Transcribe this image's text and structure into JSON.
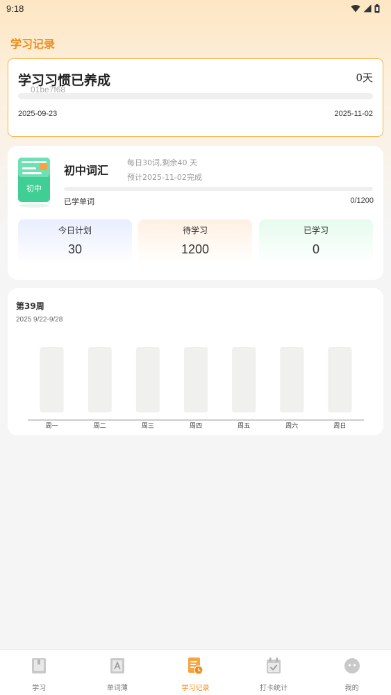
{
  "status_bar": {
    "time": "9:18"
  },
  "page": {
    "title": "学习记录"
  },
  "habit": {
    "title": "学习习惯已养成",
    "days": "0天",
    "code": "01be7f68",
    "progress": 0,
    "start_date": "2025-09-23",
    "end_date": "2025-11-02"
  },
  "vocab": {
    "name": "初中词汇",
    "badge": "初中",
    "daily_plan": "每日30词,剩余40 天",
    "eta": "预计2025-11-02完成",
    "learned_label": "已学单词",
    "learned_count": "0/1200",
    "progress": 0,
    "stats": [
      {
        "label": "今日计划",
        "value": "30"
      },
      {
        "label": "待学习",
        "value": "1200"
      },
      {
        "label": "已学习",
        "value": "0"
      }
    ]
  },
  "week": {
    "title": "第39周",
    "range": "2025 9/22-9/28"
  },
  "chart_data": {
    "type": "bar",
    "categories": [
      "周一",
      "周二",
      "周三",
      "周四",
      "周五",
      "周六",
      "周日"
    ],
    "values": [
      0,
      0,
      0,
      0,
      0,
      0,
      0
    ],
    "title": "",
    "xlabel": "",
    "ylabel": "",
    "grid": false
  },
  "nav": {
    "items": [
      {
        "label": "学习",
        "icon": "book-icon",
        "active": false
      },
      {
        "label": "单词薄",
        "icon": "letter-a-icon",
        "active": false
      },
      {
        "label": "学习记录",
        "icon": "record-clock-icon",
        "active": true
      },
      {
        "label": "打卡统计",
        "icon": "calendar-check-icon",
        "active": false
      },
      {
        "label": "我的",
        "icon": "profile-icon",
        "active": false
      }
    ]
  },
  "colors": {
    "accent": "#f08c1a",
    "habit_border": "#f7b34a",
    "book_green": "#3fcf94",
    "bar_bg": "#efefef"
  }
}
